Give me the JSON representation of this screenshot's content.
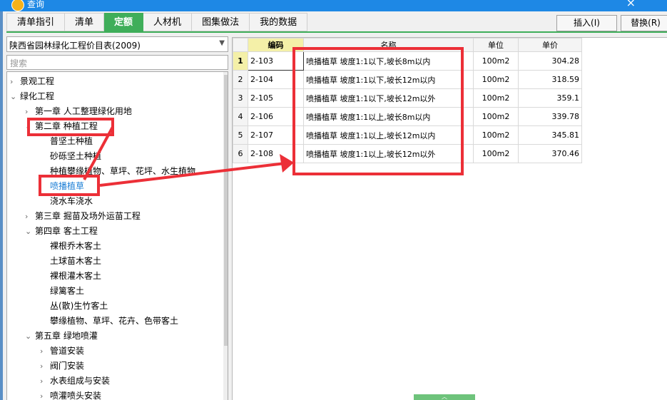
{
  "window": {
    "title": "查询",
    "close_label": "×"
  },
  "tabs": [
    {
      "label": "清单指引",
      "active": false
    },
    {
      "label": "清单",
      "active": false
    },
    {
      "label": "定额",
      "active": true
    },
    {
      "label": "人材机",
      "active": false
    },
    {
      "label": "图集做法",
      "active": false
    },
    {
      "label": "我的数据",
      "active": false
    }
  ],
  "toolbar": {
    "insert_label": "插入(I)",
    "replace_label": "替换(R)"
  },
  "library": {
    "selected": "陕西省园林绿化工程价目表(2009)"
  },
  "search": {
    "placeholder": "搜索"
  },
  "tree": [
    {
      "label": "景观工程",
      "depth": 0,
      "expander": "›"
    },
    {
      "label": "绿化工程",
      "depth": 0,
      "expander": "⌄"
    },
    {
      "label": "第一章 人工整理绿化用地",
      "depth": 1,
      "expander": "›"
    },
    {
      "label": "第二章 种植工程",
      "depth": 1,
      "expander": "⌄"
    },
    {
      "label": "普坚土种植",
      "depth": 2,
      "expander": ""
    },
    {
      "label": "砂砾坚土种植",
      "depth": 2,
      "expander": ""
    },
    {
      "label": "种植攀缘植物、草坪、花坪、水生植物",
      "depth": 2,
      "expander": ""
    },
    {
      "label": "喷播植草",
      "depth": 2,
      "expander": "",
      "selected": true
    },
    {
      "label": "浇水车浇水",
      "depth": 2,
      "expander": ""
    },
    {
      "label": "第三章 掘苗及场外运苗工程",
      "depth": 1,
      "expander": "›"
    },
    {
      "label": "第四章 客土工程",
      "depth": 1,
      "expander": "⌄"
    },
    {
      "label": "裸根乔木客土",
      "depth": 2,
      "expander": ""
    },
    {
      "label": "土球苗木客土",
      "depth": 2,
      "expander": ""
    },
    {
      "label": "裸根灌木客土",
      "depth": 2,
      "expander": ""
    },
    {
      "label": "绿篱客土",
      "depth": 2,
      "expander": ""
    },
    {
      "label": "丛(散)生竹客土",
      "depth": 2,
      "expander": ""
    },
    {
      "label": "攀缘植物、草坪、花卉、色带客土",
      "depth": 2,
      "expander": ""
    },
    {
      "label": "第五章 绿地喷灌",
      "depth": 1,
      "expander": "⌄"
    },
    {
      "label": "管道安装",
      "depth": 2,
      "expander": "›"
    },
    {
      "label": "阀门安装",
      "depth": 2,
      "expander": "›"
    },
    {
      "label": "水表组成与安装",
      "depth": 2,
      "expander": "›"
    },
    {
      "label": "喷灌喷头安装",
      "depth": 2,
      "expander": "›"
    }
  ],
  "grid": {
    "columns": [
      "编码",
      "名称",
      "单位",
      "单价"
    ],
    "rows": [
      {
        "n": "1",
        "code": "2-103",
        "name": "喷播植草 坡度1:1以下,坡长8m以内",
        "unit": "100m2",
        "price": "304.28"
      },
      {
        "n": "2",
        "code": "2-104",
        "name": "喷播植草 坡度1:1以下,坡长12m以内",
        "unit": "100m2",
        "price": "318.59"
      },
      {
        "n": "3",
        "code": "2-105",
        "name": "喷播植草 坡度1:1以下,坡长12m以外",
        "unit": "100m2",
        "price": "359.1"
      },
      {
        "n": "4",
        "code": "2-106",
        "name": "喷播植草 坡度1:1以上,坡长8m以内",
        "unit": "100m2",
        "price": "339.78"
      },
      {
        "n": "5",
        "code": "2-107",
        "name": "喷播植草 坡度1:1以上,坡长12m以内",
        "unit": "100m2",
        "price": "345.81"
      },
      {
        "n": "6",
        "code": "2-108",
        "name": "喷播植草 坡度1:1以上,坡长12m以外",
        "unit": "100m2",
        "price": "370.46"
      }
    ]
  },
  "colors": {
    "accent": "#3fae5a",
    "highlight": "#ec2f37",
    "titlebar": "#1e88e5"
  }
}
